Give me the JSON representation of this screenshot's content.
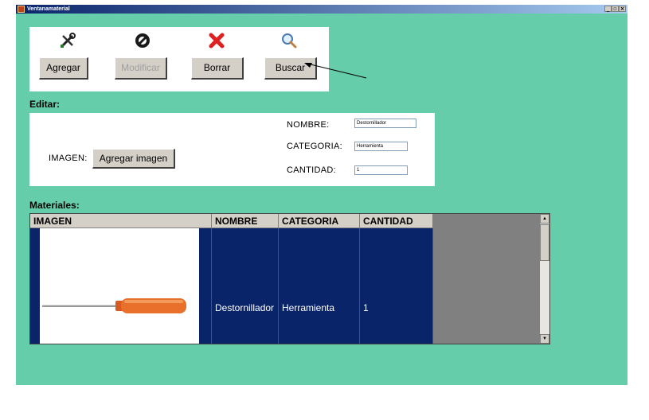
{
  "window": {
    "title": "Ventanamaterial",
    "controls": [
      "_",
      "▫",
      "×"
    ]
  },
  "toolbar": {
    "add_label": "Agregar",
    "modify_label": "Modificar",
    "delete_label": "Borrar",
    "search_label": "Buscar",
    "icons": [
      "tools-icon",
      "no-entry-icon",
      "delete-x-icon",
      "magnifier-icon"
    ]
  },
  "edit_section": {
    "title": "Editar:",
    "image_label": "IMAGEN:",
    "add_image_label": "Agregar imagen",
    "name_label": "NOMBRE:",
    "name_value": "Destornillador",
    "category_label": "CATEGORIA:",
    "category_value": "Herramienta",
    "quantity_label": "CANTIDAD:",
    "quantity_value": "1"
  },
  "materials_section": {
    "title": "Materiales:",
    "columns": [
      "IMAGEN",
      "NOMBRE",
      "CATEGORIA",
      "CANTIDAD"
    ],
    "rows": [
      {
        "nombre": "Destornillador",
        "categoria": "Herramienta",
        "cantidad": "1"
      }
    ]
  },
  "colors": {
    "background": "#66cdaa",
    "selection": "#0a246a",
    "delete_red": "#e02020"
  }
}
